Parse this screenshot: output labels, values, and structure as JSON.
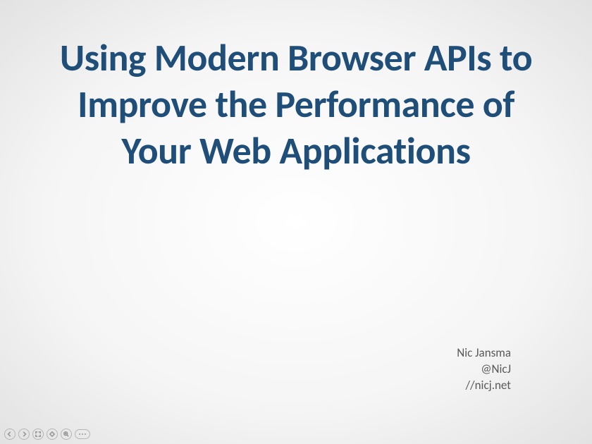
{
  "slide": {
    "title": "Using Modern Browser APIs to Improve the Performance of Your Web Applications",
    "author": {
      "name": "Nic Jansma",
      "handle": "@NicJ",
      "url": "//nicj.net"
    }
  },
  "toolbar": {
    "prev": "prev",
    "next": "next",
    "fullscreen": "fullscreen",
    "zoom_out": "zoom-out",
    "zoom_in": "zoom-in",
    "more": "more"
  }
}
